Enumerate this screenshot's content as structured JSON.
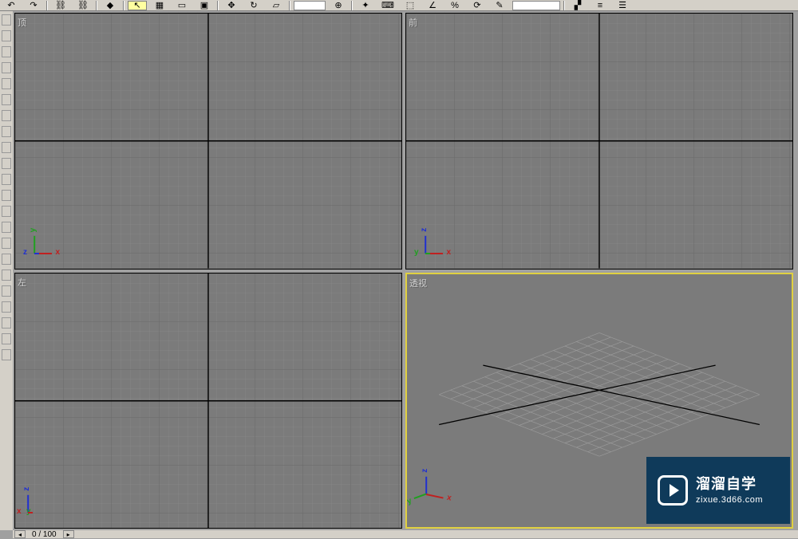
{
  "toolbar": {
    "icons": [
      "undo",
      "redo",
      "sep",
      "link",
      "unlink",
      "sep",
      "select",
      "select-region",
      "select-name",
      "selection-filter",
      "sep",
      "move",
      "rotate",
      "scale",
      "sep",
      "ref-coord",
      "sep",
      "mirror",
      "align",
      "array",
      "snap",
      "angle-snap",
      "percent-snap",
      "spinner-snap",
      "sep",
      "named-sel",
      "sep",
      "mirror2",
      "align2",
      "layers",
      "curve-editor",
      "schematic",
      "material",
      "render"
    ]
  },
  "sidebar": {
    "items": [
      "tool1",
      "tool2",
      "tool3",
      "tool4",
      "tool5",
      "tool6",
      "tool7",
      "tool8",
      "tool9",
      "tool10",
      "tool11",
      "tool12",
      "tool13",
      "tool14",
      "tool15",
      "tool16",
      "tool17",
      "tool18",
      "tool19",
      "tool20",
      "tool21",
      "tool22"
    ]
  },
  "viewports": {
    "top": {
      "label": "顶",
      "axes": {
        "h": "x",
        "v": "y",
        "d": "z"
      }
    },
    "front": {
      "label": "前",
      "axes": {
        "h": "x",
        "v": "z",
        "d": "y"
      }
    },
    "left": {
      "label": "左",
      "axes": {
        "h": "y",
        "v": "z",
        "d": "x"
      }
    },
    "persp": {
      "label": "透视",
      "active": true
    }
  },
  "persp_axes": {
    "x": "x",
    "y": "y",
    "z": "z"
  },
  "status": {
    "frame": "0 / 100"
  },
  "watermark": {
    "title": "溜溜自学",
    "url": "zixue.3d66.com"
  }
}
